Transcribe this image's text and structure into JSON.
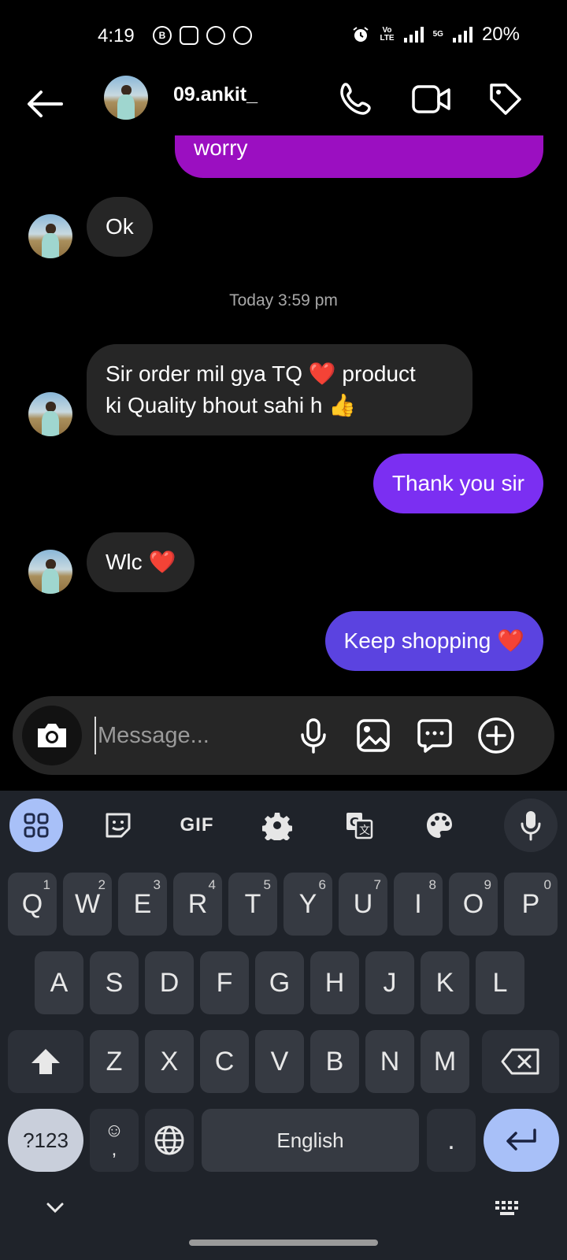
{
  "status_bar": {
    "time": "4:19",
    "network_label": "5G",
    "volte_label": "VoLTE",
    "battery": "20%"
  },
  "header": {
    "username": "09.ankit_",
    "icons": [
      "back-arrow-icon",
      "phone-icon",
      "video-camera-icon",
      "tag-icon"
    ]
  },
  "messages": {
    "partial_outgoing": "worry",
    "incoming_1": "Ok",
    "timestamp": "Today 3:59 pm",
    "incoming_2_line1": "Sir order mil gya TQ ",
    "incoming_2_heart": "❤️",
    "incoming_2_line1b": " product",
    "incoming_2_line2": "ki Quality bhout sahi h ",
    "incoming_2_thumb": "👍",
    "outgoing_1": "Thank you sir",
    "incoming_3": "Wlc ",
    "incoming_3_heart": "❤️",
    "outgoing_2": "Keep shopping ",
    "outgoing_2_heart": "❤️"
  },
  "composer": {
    "placeholder": "Message..."
  },
  "keyboard": {
    "toolbar_gif": "GIF",
    "row1": [
      {
        "letter": "Q",
        "num": "1"
      },
      {
        "letter": "W",
        "num": "2"
      },
      {
        "letter": "E",
        "num": "3"
      },
      {
        "letter": "R",
        "num": "4"
      },
      {
        "letter": "T",
        "num": "5"
      },
      {
        "letter": "Y",
        "num": "6"
      },
      {
        "letter": "U",
        "num": "7"
      },
      {
        "letter": "I",
        "num": "8"
      },
      {
        "letter": "O",
        "num": "9"
      },
      {
        "letter": "P",
        "num": "0"
      }
    ],
    "row2": [
      "A",
      "S",
      "D",
      "F",
      "G",
      "H",
      "J",
      "K",
      "L"
    ],
    "row3": [
      "Z",
      "X",
      "C",
      "V",
      "B",
      "N",
      "M"
    ],
    "symbols_key": "?123",
    "comma_key": ",",
    "space_label": "English",
    "period_key": "."
  },
  "colors": {
    "outgoing_purple": "#9b0fc1",
    "outgoing_violet": "#7b2ff2",
    "outgoing_indigo": "#5b43e0",
    "incoming_bg": "#262626",
    "keyboard_bg": "#1f232a",
    "accent_blue": "#a8c0f8"
  }
}
